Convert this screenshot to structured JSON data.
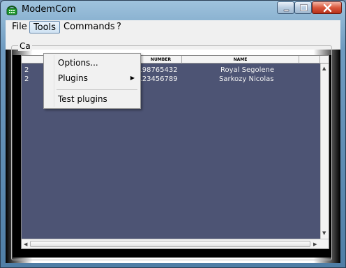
{
  "window": {
    "title": "ModemCom",
    "icon": "phone-icon"
  },
  "menubar": {
    "items": [
      "File",
      "Tools",
      "Commands",
      "?"
    ],
    "open_item": "Tools"
  },
  "tools_menu": {
    "items": [
      {
        "label": "Options..."
      },
      {
        "label": "Plugins",
        "submenu": true
      },
      {
        "label": "Test plugins"
      }
    ]
  },
  "group": {
    "label": "Ca"
  },
  "table": {
    "columns": [
      "NUMBER",
      "NAME"
    ],
    "rows": [
      {
        "date_fragment": "2",
        "number": "0198765432",
        "name": "Royal Segolene"
      },
      {
        "date_fragment": "2",
        "number": "0123456789",
        "name": "Sarkozy Nicolas"
      }
    ]
  },
  "colors": {
    "table_bg": "#4d5474",
    "close_button": "#c8442a"
  }
}
